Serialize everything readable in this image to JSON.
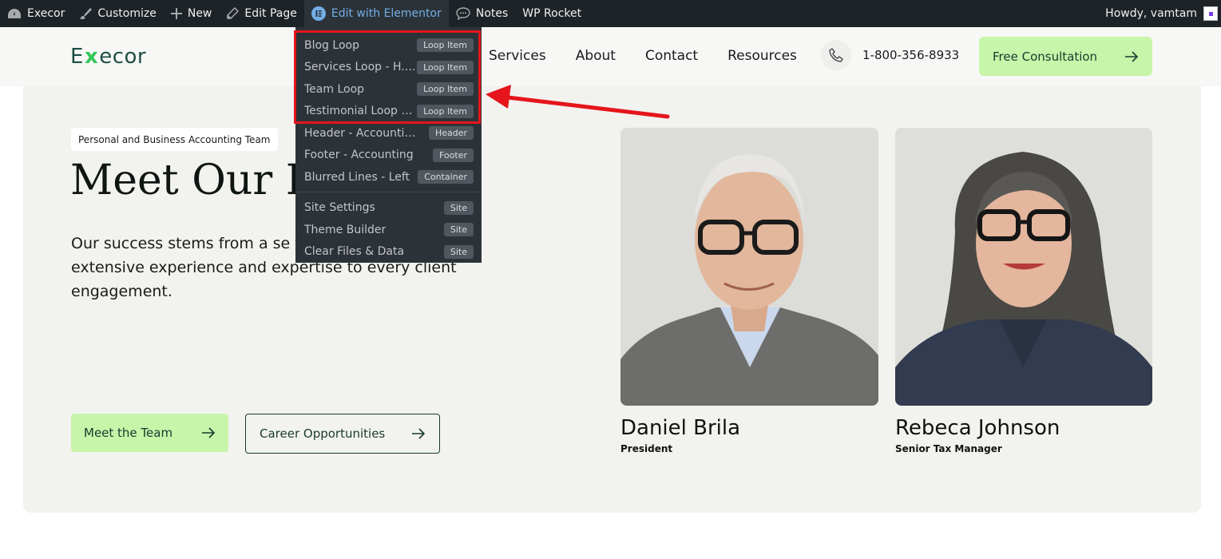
{
  "adminbar": {
    "site": "Execor",
    "customize": "Customize",
    "new": "New",
    "edit_page": "Edit Page",
    "edit_elementor": "Edit with Elementor",
    "notes": "Notes",
    "wp_rocket": "WP Rocket",
    "howdy": "Howdy, vamtam"
  },
  "dropdown": {
    "items": [
      {
        "label": "Blog Loop",
        "tag": "Loop Item"
      },
      {
        "label": "Services Loop - H. ...",
        "tag": "Loop Item"
      },
      {
        "label": "Team Loop",
        "tag": "Loop Item"
      },
      {
        "label": "Testimonial Loop - ...",
        "tag": "Loop Item"
      },
      {
        "label": "Header - Accounting",
        "tag": "Header"
      },
      {
        "label": "Footer - Accounting",
        "tag": "Footer"
      },
      {
        "label": "Blurred Lines - Left",
        "tag": "Container"
      }
    ],
    "site_items": [
      {
        "label": "Site Settings",
        "tag": "Site"
      },
      {
        "label": "Theme Builder",
        "tag": "Site"
      },
      {
        "label": "Clear Files & Data",
        "tag": "Site"
      }
    ]
  },
  "header": {
    "logo_left": "E",
    "logo_x": "x",
    "logo_right": "ecor",
    "nav": [
      "Services",
      "About",
      "Contact",
      "Resources"
    ],
    "phone": "1-800-356-8933",
    "cta": "Free Consultation"
  },
  "hero": {
    "badge": "Personal and Business Accounting Team",
    "heading": "Meet Our Le",
    "lead": "Our success stems from a se team bringing extensive experience and expertise to every client engagement.",
    "btn_team": "Meet the Team",
    "btn_career": "Career Opportunities"
  },
  "team": [
    {
      "name": "Daniel Brila",
      "role": "President"
    },
    {
      "name": "Rebeca Johnson",
      "role": "Senior Tax Manager"
    }
  ],
  "colors": {
    "accent_green": "#c7f5a9",
    "highlight_red": "#e5151b",
    "adminbar_bg": "#1d2327",
    "elementor_blue": "#72aee6"
  }
}
